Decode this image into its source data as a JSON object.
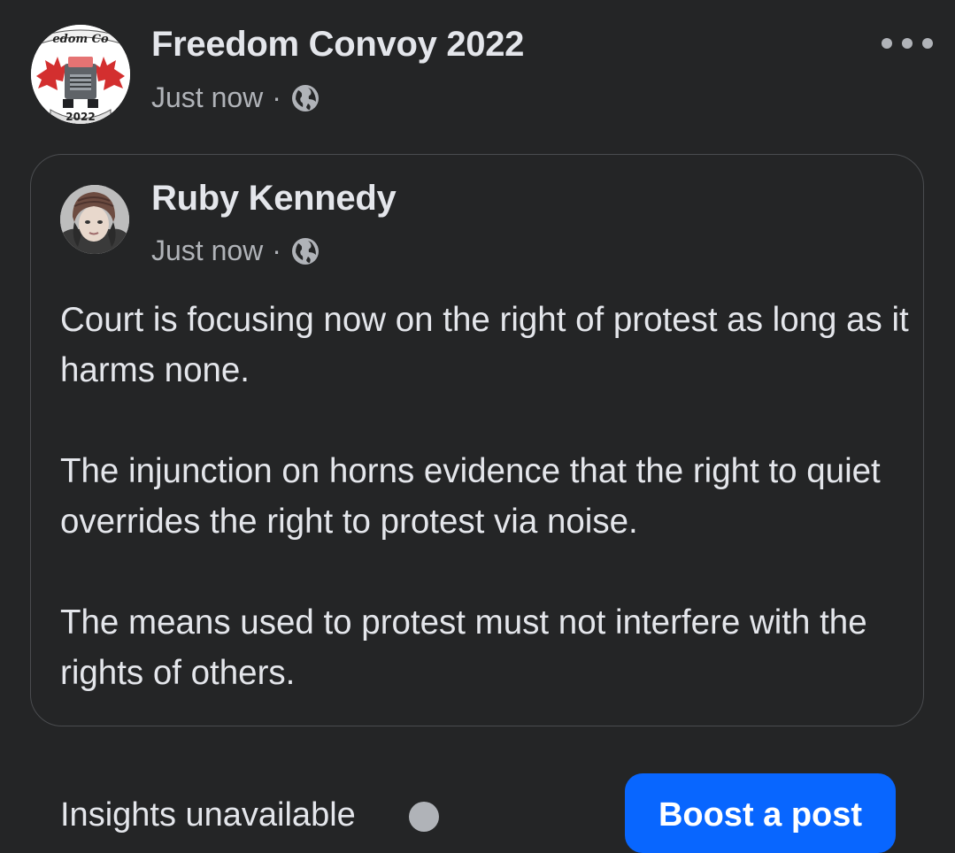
{
  "post": {
    "page_name": "Freedom Convoy 2022",
    "time": "Just now",
    "separator": "·",
    "page_avatar": {
      "top_text": "edom Co",
      "year": "2022"
    },
    "icons": {
      "privacy": "globe-icon",
      "more": "more-options-icon"
    }
  },
  "shared": {
    "author": "Ruby Kennedy",
    "time": "Just now",
    "separator": "·",
    "paragraphs": [
      "Court is focusing now on the right of protest as long as it harms none.",
      "The injunction on horns evidence that the right to quiet overrides the right to protest via noise.",
      "The means used to protest must not interfere with the rights of others."
    ]
  },
  "footer": {
    "insights": "Insights unavailable",
    "boost_label": "Boost a post"
  },
  "colors": {
    "background": "#242526",
    "text_primary": "#e4e6eb",
    "text_secondary": "#b0b3b8",
    "card_border": "#4a4c4f",
    "accent": "#0866ff"
  }
}
